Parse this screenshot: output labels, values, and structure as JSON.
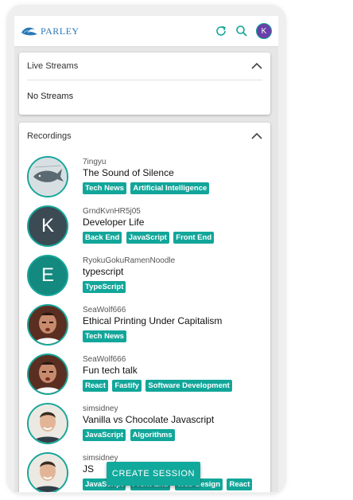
{
  "app": {
    "name": "PARLEY",
    "user_initial": "K"
  },
  "live_streams": {
    "header": "Live Streams",
    "empty": "No Streams"
  },
  "recordings": {
    "header": "Recordings",
    "items": [
      {
        "user": "7ingyu",
        "title": "The Sound of Silence",
        "avatar": "whale-image",
        "tags": [
          "Tech News",
          "Artificial Intelligence"
        ]
      },
      {
        "user": "GrndKvnHR5j05",
        "title": "Developer Life",
        "avatar": "K",
        "tags": [
          "Back End",
          "JavaScript",
          "Front End"
        ]
      },
      {
        "user": "RyokuGokuRamenNoodle",
        "title": "typescript",
        "avatar": "E",
        "tags": [
          "TypeScript"
        ]
      },
      {
        "user": "SeaWolf666",
        "title": "Ethical Printing Under Capitalism",
        "avatar": "photo",
        "tags": [
          "Tech News"
        ]
      },
      {
        "user": "SeaWolf666",
        "title": "Fun tech talk",
        "avatar": "photo",
        "tags": [
          "React",
          "Fastify",
          "Software Development"
        ]
      },
      {
        "user": "simsidney",
        "title": "Vanilla vs Chocolate Javascript",
        "avatar": "photo",
        "tags": [
          "JavaScript",
          "Algorithms"
        ]
      },
      {
        "user": "simsidney",
        "title": "JS",
        "avatar": "photo",
        "tags": [
          "JavaScript",
          "Front End",
          "Web Design",
          "React"
        ]
      }
    ]
  },
  "fab_label": "CREATE SESSION",
  "colors": {
    "accent": "#12a69a",
    "brand": "#2a78b6"
  }
}
